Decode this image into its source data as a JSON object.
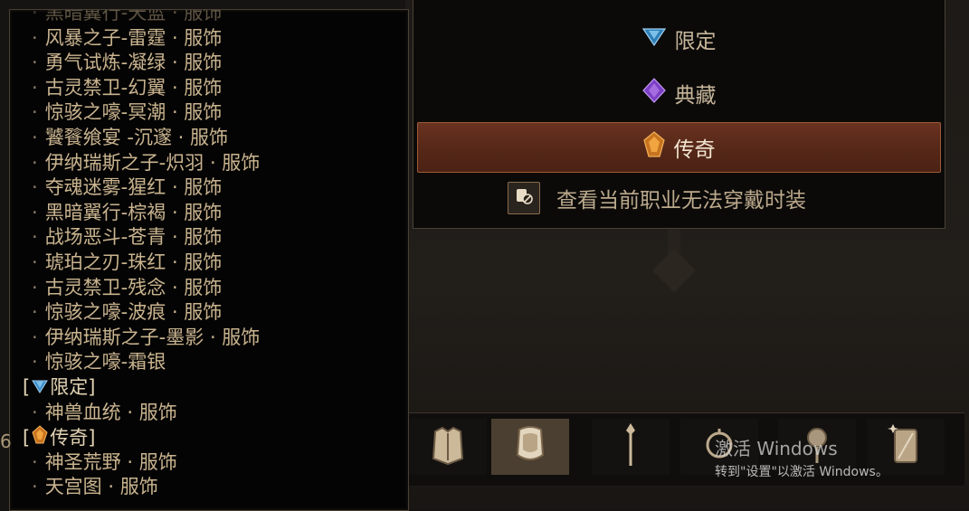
{
  "list": {
    "top_partial": "黑暗翼行-天蓝 · 服饰",
    "items": [
      "风暴之子-雷霆 · 服饰",
      "勇气试炼-凝绿 · 服饰",
      "古灵禁卫-幻翼 · 服饰",
      "惊骇之嚎-冥潮 · 服饰",
      "饕餮飨宴 -沉邃 · 服饰",
      "伊纳瑞斯之子-炽羽 · 服饰",
      "夺魂迷雾-猩红 · 服饰",
      "黑暗翼行-棕褐 · 服饰",
      "战场恶斗-苍青 · 服饰",
      "琥珀之刃-珠红 · 服饰",
      "古灵禁卫-残念 · 服饰",
      "惊骇之嚎-波痕 · 服饰",
      "伊纳瑞斯之子-墨影 · 服饰",
      "惊骇之嚎-霜银"
    ],
    "group_limited": "限定",
    "limited_items": [
      "神兽血统 · 服饰"
    ],
    "group_legendary": "传奇",
    "legendary_items": [
      "神圣荒野 · 服饰",
      "天宫图 · 服饰"
    ],
    "bullet": "·",
    "bracket_open": "[",
    "bracket_close": "]",
    "left_edge_char": "6"
  },
  "filter": {
    "options": [
      {
        "label": "限定",
        "gem": "blue-triangle-gem-icon",
        "color": "#3d8ec9"
      },
      {
        "label": "典藏",
        "gem": "purple-diamond-gem-icon",
        "color": "#8a4fd0"
      },
      {
        "label": "传奇",
        "gem": "orange-crest-gem-icon",
        "color": "#d98a2b",
        "selected": true
      }
    ],
    "hide_label": "查看当前职业无法穿戴时装"
  },
  "slots": [
    {
      "name": "chest-armor-icon"
    },
    {
      "name": "cape-armor-icon",
      "active": true
    },
    {
      "name": "staff-weapon-icon"
    },
    {
      "name": "amulet-icon"
    },
    {
      "name": "orb-icon"
    },
    {
      "name": "mirror-frame-icon"
    }
  ],
  "watermark": {
    "title": "激活 Windows",
    "subtitle": "转到\"设置\"以激活 Windows。"
  }
}
